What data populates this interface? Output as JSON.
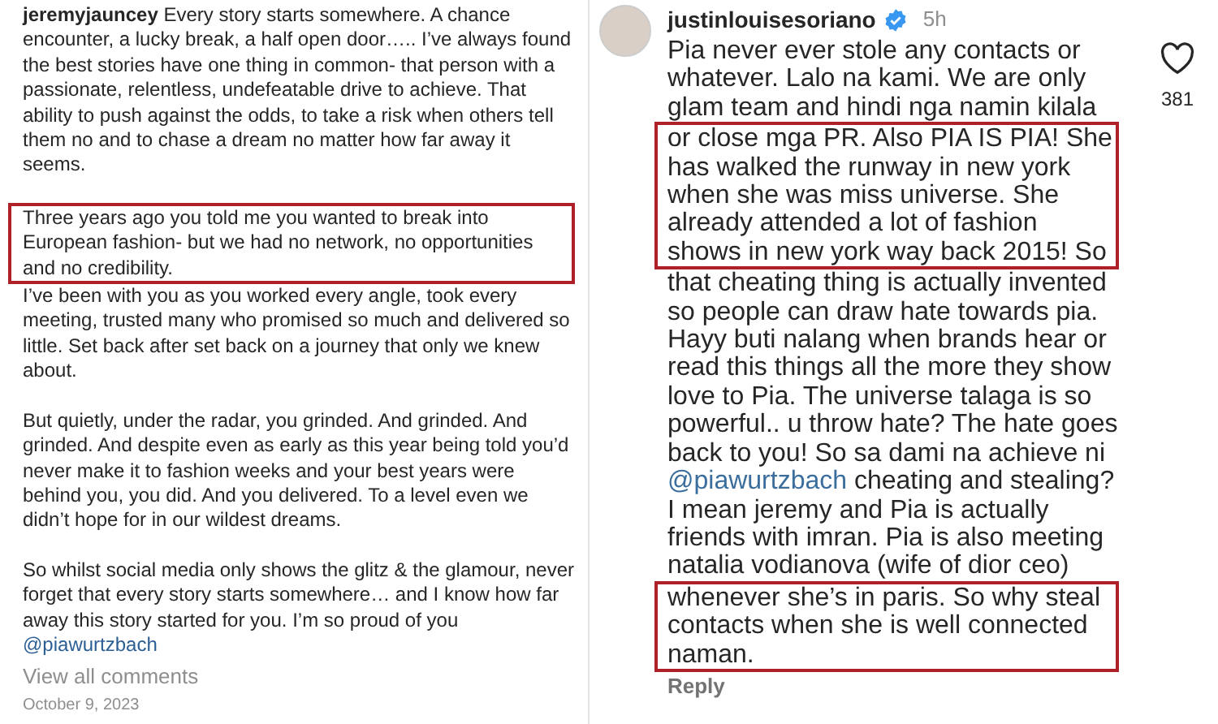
{
  "left_post": {
    "username": "jeremyjauncey",
    "paragraphs": [
      {
        "text": "Every story starts somewhere. A chance encounter, a lucky break, a half open door….. I’ve always found the best stories have one thing in common- that person with a passionate, relentless, undefeatable drive to achieve. That ability to push against the odds, to take a risk when others tell them no and to chase a dream no matter how far away it seems.",
        "highlighted": false
      },
      {
        "text": "Three years ago you told me you wanted to break into European fashion- but we had no network, no opportunities and no credibility.",
        "highlighted": true
      },
      {
        "text": "I’ve been with you as you worked every angle, took every meeting, trusted many who promised so much and delivered so little. Set back after set back on a journey that only we knew about.",
        "highlighted": false
      },
      {
        "text": "But quietly, under the radar, you grinded. And grinded. And grinded. And despite even as early as this year being told you’d never make it to fashion weeks and your best years were behind you, you did. And you delivered. To a level even we didn’t hope for in our wildest dreams.",
        "highlighted": false
      },
      {
        "text": "So whilst social media only shows the glitz & the glamour, never forget that every story starts somewhere… and I know how far away this story started for you. I’m so proud of you",
        "highlighted": false
      }
    ],
    "mention": "@piawurtzbach",
    "view_all": "View all comments",
    "date": "October 9, 2023"
  },
  "right_comment": {
    "username": "justinlouisesoriano",
    "verified": true,
    "time": "5h",
    "likes": "381",
    "reply": "Reply",
    "lines": [
      {
        "text": "Pia never ever stole any contacts or",
        "highlighted": false
      },
      {
        "text": "whatever. Lalo na kami. We are only",
        "highlighted": false
      },
      {
        "text": "glam team and hindi nga namin kilala",
        "highlighted": false
      },
      {
        "text": "or close mga PR. Also PIA IS PIA! She",
        "highlighted": true
      },
      {
        "text": "has walked the runway in new york",
        "highlighted": true
      },
      {
        "text": "when she was miss universe. She",
        "highlighted": true
      },
      {
        "text": "already attended a lot of fashion",
        "highlighted": true
      },
      {
        "text": "shows in new york way back 2015! So",
        "highlighted": true
      },
      {
        "text": "that cheating thing is actually invented",
        "highlighted": false
      },
      {
        "text": "so people can draw hate towards pia.",
        "highlighted": false
      },
      {
        "text": "Hayy buti nalang when brands hear or",
        "highlighted": false
      },
      {
        "text": "read this things all the more they show",
        "highlighted": false
      },
      {
        "text": "love to Pia. The universe talaga is so",
        "highlighted": false
      },
      {
        "text": "powerful.. u throw hate? The hate goes",
        "highlighted": false
      },
      {
        "text": "back to you! So sa dami na achieve ni",
        "highlighted": false
      },
      {
        "mention": "@piawurtzbach",
        "text": "cheating and stealing?",
        "highlighted": false
      },
      {
        "text": "I mean jeremy and Pia is actually",
        "highlighted": false
      },
      {
        "text": "friends with imran. Pia is also meeting",
        "highlighted": false
      },
      {
        "text": "natalia vodianova (wife of dior ceo)",
        "highlighted": false
      },
      {
        "text": "whenever she’s in paris. So why steal",
        "highlighted": true
      },
      {
        "text": "contacts when she is well connected",
        "highlighted": true
      },
      {
        "text": "naman.",
        "highlighted": true
      }
    ]
  }
}
